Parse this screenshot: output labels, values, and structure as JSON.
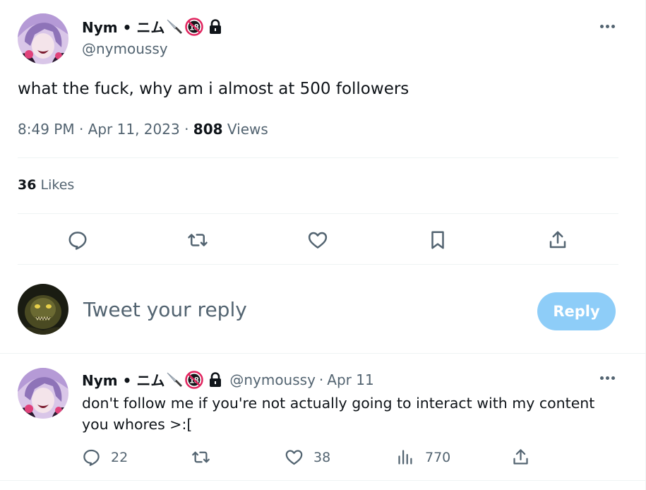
{
  "main_tweet": {
    "display_name": "Nym • ニム",
    "handle": "@nymoussy",
    "text": "what the fuck, why am i almost at 500 followers",
    "time": "8:49 PM",
    "date": "Apr 11, 2023",
    "views_count": "808",
    "views_label": "Views",
    "likes_count": "36",
    "likes_label": "Likes"
  },
  "reply_composer": {
    "placeholder": "Tweet your reply",
    "button_label": "Reply"
  },
  "reply_tweet": {
    "display_name": "Nym • ニム",
    "handle": "@nymoussy",
    "date": "Apr 11",
    "text": "don't follow me if you're not actually going to interact with my content you whores >:[",
    "reply_count": "22",
    "retweet_count": "",
    "like_count": "38",
    "view_count": "770"
  },
  "separators": {
    "dot": "·"
  },
  "badge": {
    "age_text": "18"
  },
  "colors": {
    "text_primary": "#0f1419",
    "text_secondary": "#536471",
    "divider": "#eff3f4",
    "reply_button_disabled": "#8ecdf8",
    "badge_red": "#e0245e"
  },
  "icons": [
    "knife-icon",
    "age-18-badge-icon",
    "lock-icon",
    "more-icon",
    "reply-icon",
    "retweet-icon",
    "like-icon",
    "bookmark-icon",
    "share-icon",
    "views-icon"
  ]
}
